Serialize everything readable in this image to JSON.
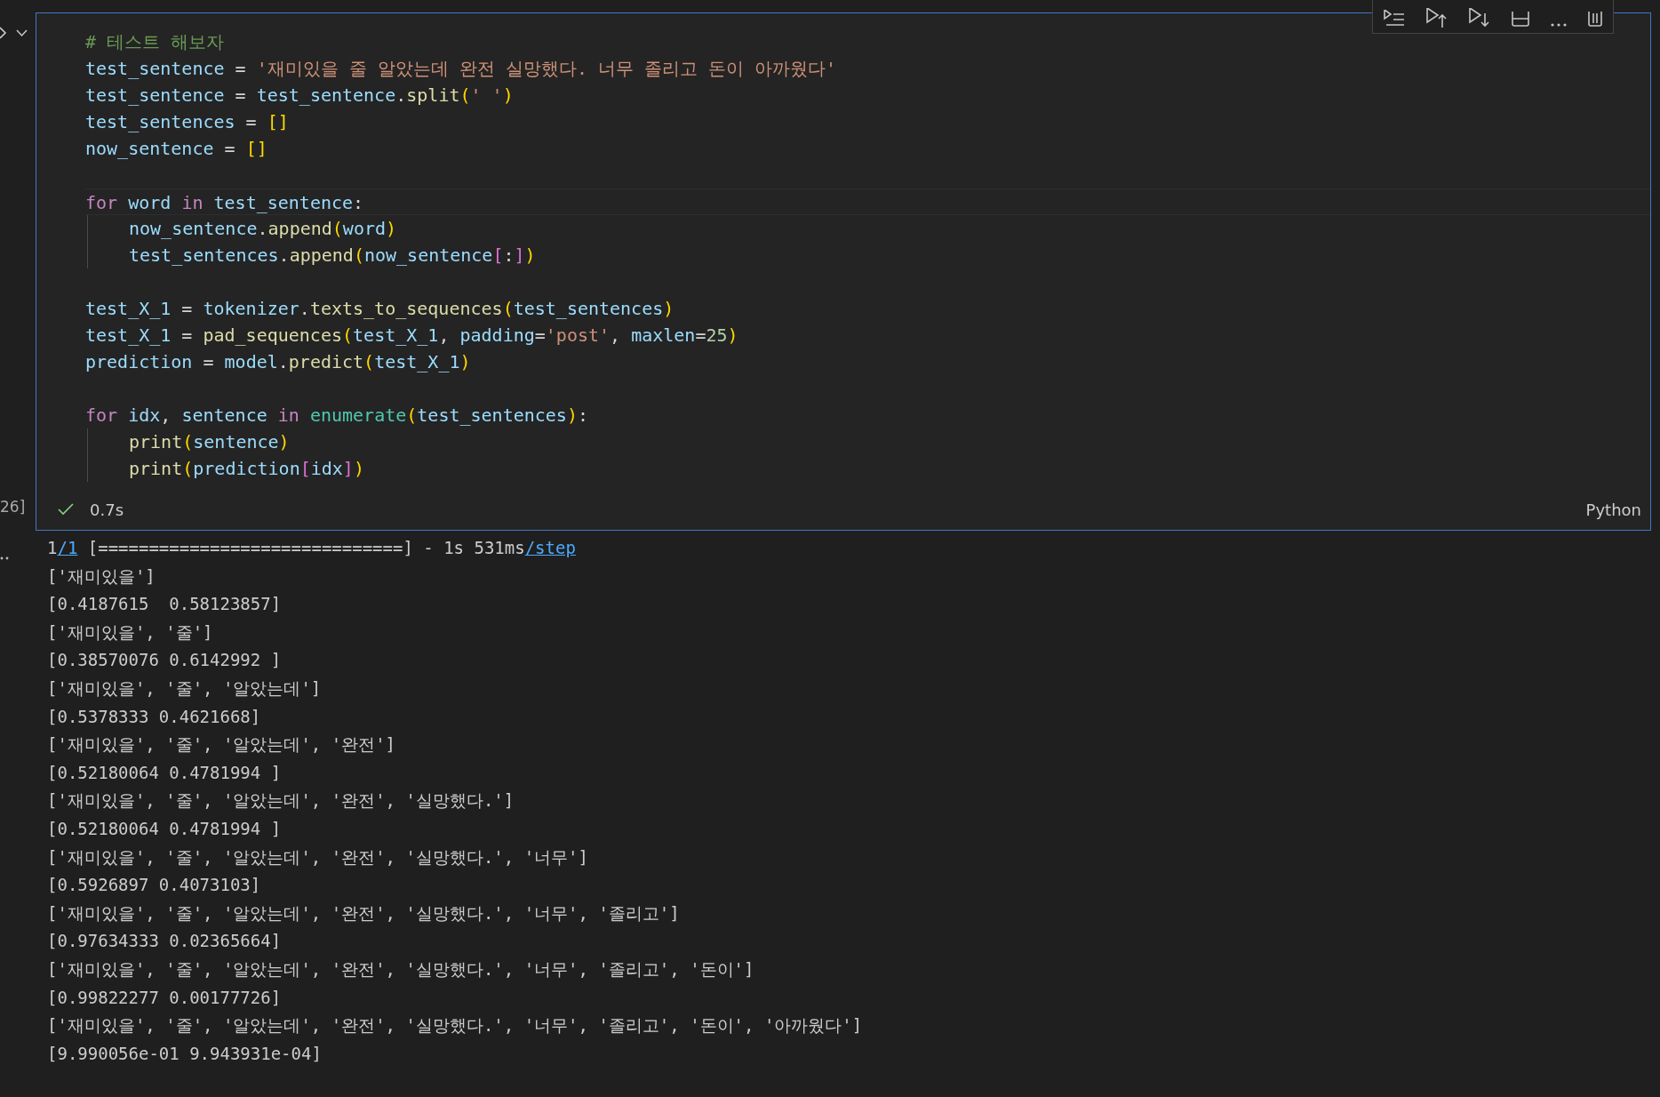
{
  "cell": {
    "code": [
      {
        "lines": [
          {
            "highlighted": false,
            "tokens": [
              {
                "kind": "comment",
                "text": "# 테스트 해보자"
              }
            ]
          },
          {
            "highlighted": false,
            "tokens": [
              {
                "kind": "variable",
                "text": "test_sentence"
              },
              {
                "kind": "punct",
                "text": " = "
              },
              {
                "kind": "string",
                "text": "'재미있을 줄 알았는데 완전 실망했다. 너무 졸리고 돈이 아까웠다'"
              }
            ]
          },
          {
            "highlighted": false,
            "tokens": [
              {
                "kind": "variable",
                "text": "test_sentence"
              },
              {
                "kind": "punct",
                "text": " = "
              },
              {
                "kind": "variable",
                "text": "test_sentence"
              },
              {
                "kind": "punct",
                "text": "."
              },
              {
                "kind": "function",
                "text": "split"
              },
              {
                "kind": "bracket1",
                "text": "("
              },
              {
                "kind": "string",
                "text": "' '"
              },
              {
                "kind": "bracket1",
                "text": ")"
              }
            ]
          },
          {
            "highlighted": false,
            "tokens": [
              {
                "kind": "variable",
                "text": "test_sentences"
              },
              {
                "kind": "punct",
                "text": " = "
              },
              {
                "kind": "bracket1",
                "text": "[]"
              }
            ]
          },
          {
            "highlighted": false,
            "tokens": [
              {
                "kind": "variable",
                "text": "now_sentence"
              },
              {
                "kind": "punct",
                "text": " = "
              },
              {
                "kind": "bracket1",
                "text": "[]"
              }
            ]
          }
        ]
      },
      {
        "lines": [
          {
            "highlighted": true,
            "tokens": [
              {
                "kind": "keyword",
                "text": "for"
              },
              {
                "kind": "variable",
                "text": " word "
              },
              {
                "kind": "keyword",
                "text": "in"
              },
              {
                "kind": "variable",
                "text": " test_sentence"
              },
              {
                "kind": "punct",
                "text": ":"
              }
            ],
            "children": [
              {
                "highlighted": false,
                "tokens": [
                  {
                    "kind": "variable",
                    "text": "now_sentence"
                  },
                  {
                    "kind": "punct",
                    "text": "."
                  },
                  {
                    "kind": "function",
                    "text": "append"
                  },
                  {
                    "kind": "bracket1",
                    "text": "("
                  },
                  {
                    "kind": "variable",
                    "text": "word"
                  },
                  {
                    "kind": "bracket1",
                    "text": ")"
                  }
                ]
              },
              {
                "highlighted": false,
                "tokens": [
                  {
                    "kind": "variable",
                    "text": "test_sentences"
                  },
                  {
                    "kind": "punct",
                    "text": "."
                  },
                  {
                    "kind": "function",
                    "text": "append"
                  },
                  {
                    "kind": "bracket1",
                    "text": "("
                  },
                  {
                    "kind": "variable",
                    "text": "now_sentence"
                  },
                  {
                    "kind": "bracket2",
                    "text": "["
                  },
                  {
                    "kind": "punct",
                    "text": ":"
                  },
                  {
                    "kind": "bracket2",
                    "text": "]"
                  },
                  {
                    "kind": "bracket1",
                    "text": ")"
                  }
                ]
              }
            ]
          }
        ]
      },
      {
        "lines": [
          {
            "highlighted": false,
            "tokens": [
              {
                "kind": "variable",
                "text": "test_X_1"
              },
              {
                "kind": "punct",
                "text": " = "
              },
              {
                "kind": "variable",
                "text": "tokenizer"
              },
              {
                "kind": "punct",
                "text": "."
              },
              {
                "kind": "function",
                "text": "texts_to_sequences"
              },
              {
                "kind": "bracket1",
                "text": "("
              },
              {
                "kind": "variable",
                "text": "test_sentences"
              },
              {
                "kind": "bracket1",
                "text": ")"
              }
            ]
          },
          {
            "highlighted": false,
            "tokens": [
              {
                "kind": "variable",
                "text": "test_X_1"
              },
              {
                "kind": "punct",
                "text": " = "
              },
              {
                "kind": "function",
                "text": "pad_sequences"
              },
              {
                "kind": "bracket1",
                "text": "("
              },
              {
                "kind": "variable",
                "text": "test_X_1"
              },
              {
                "kind": "punct",
                "text": ", "
              },
              {
                "kind": "variable",
                "text": "padding"
              },
              {
                "kind": "punct",
                "text": "="
              },
              {
                "kind": "string",
                "text": "'post'"
              },
              {
                "kind": "punct",
                "text": ", "
              },
              {
                "kind": "variable",
                "text": "maxlen"
              },
              {
                "kind": "punct",
                "text": "="
              },
              {
                "kind": "number",
                "text": "25"
              },
              {
                "kind": "bracket1",
                "text": ")"
              }
            ]
          },
          {
            "highlighted": false,
            "tokens": [
              {
                "kind": "variable",
                "text": "prediction"
              },
              {
                "kind": "punct",
                "text": " = "
              },
              {
                "kind": "variable",
                "text": "model"
              },
              {
                "kind": "punct",
                "text": "."
              },
              {
                "kind": "function",
                "text": "predict"
              },
              {
                "kind": "bracket1",
                "text": "("
              },
              {
                "kind": "variable",
                "text": "test_X_1"
              },
              {
                "kind": "bracket1",
                "text": ")"
              }
            ]
          }
        ]
      },
      {
        "lines": [
          {
            "highlighted": false,
            "tokens": [
              {
                "kind": "keyword",
                "text": "for"
              },
              {
                "kind": "variable",
                "text": " idx"
              },
              {
                "kind": "punct",
                "text": ", "
              },
              {
                "kind": "variable",
                "text": "sentence "
              },
              {
                "kind": "keyword",
                "text": "in"
              },
              {
                "kind": "builtin",
                "text": " enumerate"
              },
              {
                "kind": "bracket1",
                "text": "("
              },
              {
                "kind": "variable",
                "text": "test_sentences"
              },
              {
                "kind": "bracket1",
                "text": ")"
              },
              {
                "kind": "punct",
                "text": ":"
              }
            ],
            "children": [
              {
                "highlighted": false,
                "tokens": [
                  {
                    "kind": "function",
                    "text": "print"
                  },
                  {
                    "kind": "bracket1",
                    "text": "("
                  },
                  {
                    "kind": "variable",
                    "text": "sentence"
                  },
                  {
                    "kind": "bracket1",
                    "text": ")"
                  }
                ]
              },
              {
                "highlighted": false,
                "tokens": [
                  {
                    "kind": "function",
                    "text": "print"
                  },
                  {
                    "kind": "bracket1",
                    "text": "("
                  },
                  {
                    "kind": "variable",
                    "text": "prediction"
                  },
                  {
                    "kind": "bracket2",
                    "text": "["
                  },
                  {
                    "kind": "variable",
                    "text": "idx"
                  },
                  {
                    "kind": "bracket2",
                    "text": "]"
                  },
                  {
                    "kind": "bracket1",
                    "text": ")"
                  }
                ]
              }
            ]
          }
        ]
      }
    ],
    "execution_count": "26]",
    "duration": "0.7s",
    "language": "Python"
  },
  "output": {
    "progress": [
      {
        "text": "1",
        "link": false
      },
      {
        "text": "/1",
        "link": true
      },
      {
        "text": " [==============================] - 1s 531ms",
        "link": false
      },
      {
        "text": "/step",
        "link": true
      }
    ],
    "lines": [
      "['재미있을']",
      "[0.4187615  0.58123857]",
      "['재미있을', '줄']",
      "[0.38570076 0.6142992 ]",
      "['재미있을', '줄', '알았는데']",
      "[0.5378333 0.4621668]",
      "['재미있을', '줄', '알았는데', '완전']",
      "[0.52180064 0.4781994 ]",
      "['재미있을', '줄', '알았는데', '완전', '실망했다.']",
      "[0.52180064 0.4781994 ]",
      "['재미있을', '줄', '알았는데', '완전', '실망했다.', '너무']",
      "[0.5926897 0.4073103]",
      "['재미있을', '줄', '알았는데', '완전', '실망했다.', '너무', '졸리고']",
      "[0.97634333 0.02365664]",
      "['재미있을', '줄', '알았는데', '완전', '실망했다.', '너무', '졸리고', '돈이']",
      "[0.99822277 0.00177726]",
      "['재미있을', '줄', '알았는데', '완전', '실망했다.', '너무', '졸리고', '돈이', '아까웠다']",
      "[9.990056e-01 9.943931e-04]"
    ]
  }
}
